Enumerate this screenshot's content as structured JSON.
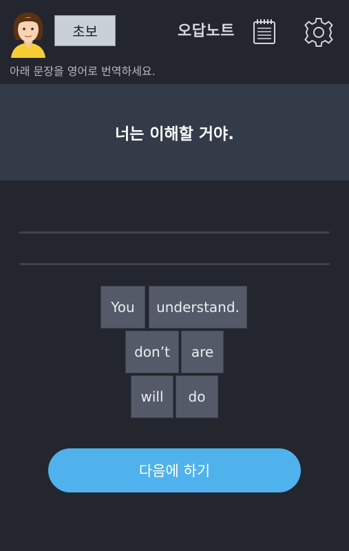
{
  "header": {
    "level_label": "초보",
    "note_label": "오답노트",
    "instruction": "아래 문장을 영어로 번역하세요."
  },
  "prompt": {
    "sentence": "너는 이해할 거야."
  },
  "word_tiles": [
    "You",
    "understand.",
    "don’t",
    "are",
    "will",
    "do"
  ],
  "next_button_label": "다음에 하기",
  "colors": {
    "background": "#23262e",
    "prompt_panel": "#333a48",
    "tile": "#545a67",
    "level_button": "#c9d1d6",
    "next_button": "#4fb2ec"
  }
}
